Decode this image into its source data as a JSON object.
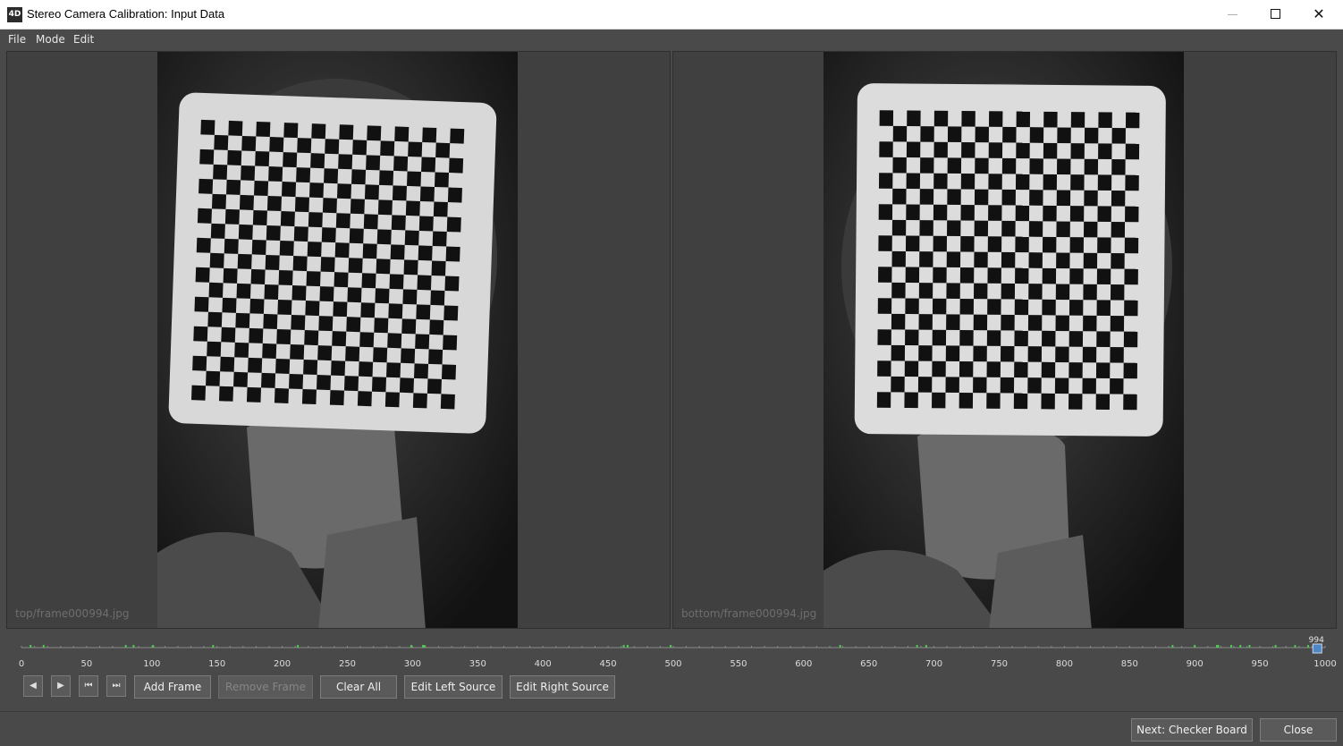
{
  "window": {
    "app_icon": "4D",
    "title": "Stereo Camera Calibration: Input Data",
    "minimize_icon": "minimize-icon",
    "maximize_icon": "maximize-icon",
    "close_icon": "close-icon"
  },
  "menu": {
    "items": [
      "File",
      "Mode",
      "Edit"
    ]
  },
  "views": {
    "left": {
      "path": "top/frame000994.jpg"
    },
    "right": {
      "path": "bottom/frame000994.jpg"
    }
  },
  "timeline": {
    "min": 0,
    "max": 1000,
    "current": 994,
    "current_label": "994",
    "tick_labels": [
      "0",
      "50",
      "100",
      "150",
      "200",
      "250",
      "300",
      "350",
      "400",
      "450",
      "500",
      "550",
      "600",
      "650",
      "700",
      "750",
      "800",
      "850",
      "900",
      "950",
      "1000"
    ],
    "marked_frames": [
      7,
      17,
      80,
      86,
      101,
      147,
      212,
      299,
      308,
      309,
      462,
      465,
      498,
      628,
      687,
      694,
      883,
      900,
      917,
      918,
      928,
      935,
      942,
      962,
      977,
      987
    ],
    "marker_color": "#4ec94e",
    "handle_color": "#4f86c6"
  },
  "controls": {
    "prev_icon": "step-back-icon",
    "play_icon": "play-icon",
    "first_icon": "skip-to-start-icon",
    "last_icon": "skip-to-end-icon",
    "add_frame": "Add Frame",
    "remove_frame": "Remove Frame",
    "clear_all": "Clear All",
    "edit_left_source": "Edit Left Source",
    "edit_right_source": "Edit Right Source"
  },
  "footer": {
    "next": "Next: Checker Board",
    "close": "Close"
  }
}
